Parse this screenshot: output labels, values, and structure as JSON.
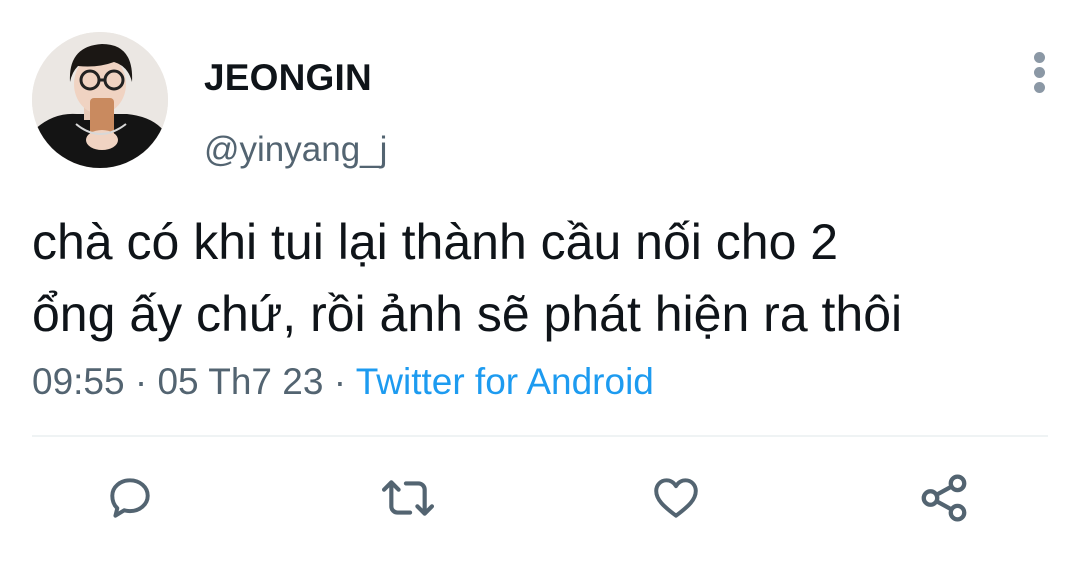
{
  "tweet": {
    "display_name": "JEONGIN",
    "handle": "@yinyang_j",
    "text": "chà có khi tui lại thành cầu nối cho 2\nổng ấy chứ, rồi ảnh sẽ phát hiện ra thôi",
    "time": "09:55",
    "separator": "·",
    "date": "05 Th7 23",
    "source": "Twitter for Android"
  },
  "icons": {
    "more": "more-vertical-icon",
    "reply": "reply-icon",
    "retweet": "retweet-icon",
    "like": "like-icon",
    "share": "share-icon"
  },
  "colors": {
    "text": "#0f1419",
    "secondary": "#536471",
    "link": "#1d9bf0",
    "icon": "#536471",
    "divider": "#eff3f4"
  }
}
